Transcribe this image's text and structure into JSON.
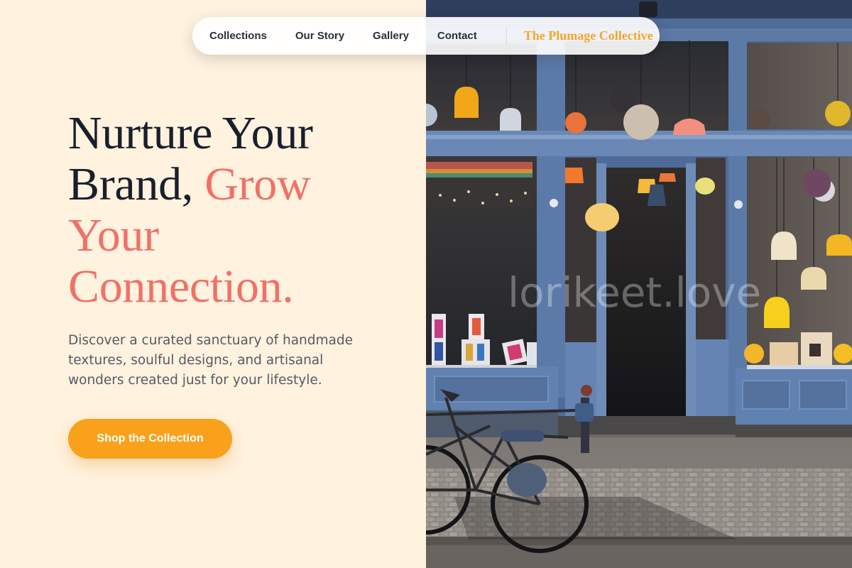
{
  "nav": {
    "links": [
      {
        "label": "Collections"
      },
      {
        "label": "Our Story"
      },
      {
        "label": "Gallery"
      },
      {
        "label": "Contact"
      }
    ],
    "brand": "The Plumage Collective"
  },
  "hero": {
    "title_lines": [
      "Nurture Your",
      "Brand,",
      "Grow",
      "Your",
      "Connection."
    ],
    "description_lines": [
      "Discover a curated sanctuary of handmade",
      "textures, soulful designs, and artisanal",
      "wonders created just for your lifestyle."
    ],
    "cta_label": "Shop the Collection"
  },
  "photo": {
    "watermark": "lorikeet.love"
  },
  "colors": {
    "background": "#fff2df",
    "heading": "#1a1f2c",
    "accent": "#f07167",
    "cta": "#f9a11b",
    "brand": "#f3a52b"
  }
}
